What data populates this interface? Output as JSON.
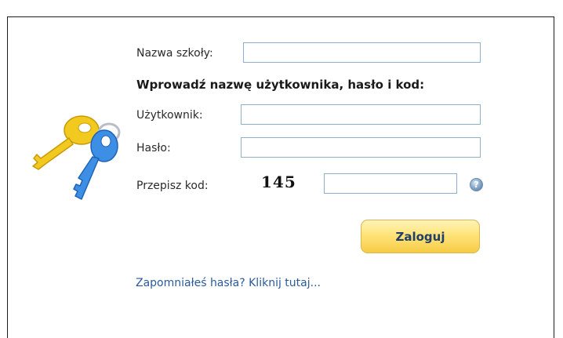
{
  "form": {
    "school_label": "Nazwa szkoły:",
    "school_value": "",
    "heading": "Wprowadź nazwę użytkownika, hasło i kod:",
    "user_label": "Użytkownik:",
    "user_value": "",
    "password_label": "Hasło:",
    "password_value": "",
    "captcha_label": "Przepisz kod:",
    "captcha_code": "145",
    "captcha_value": "",
    "help_icon": "question-mark-icon",
    "login_label": "Zaloguj",
    "forgot_link": "Zapomniałeś hasła? Kliknij tutaj..."
  },
  "illustration": {
    "icon": "keys-icon",
    "colors": {
      "gold_key": "#f2c91e",
      "blue_key": "#3d8fe6"
    }
  },
  "colors": {
    "link": "#2a5a9a",
    "button_top": "#fff4b8",
    "button_bottom": "#f6cc45",
    "button_text": "#1f3f6b",
    "field_border": "#8fb0cc"
  }
}
